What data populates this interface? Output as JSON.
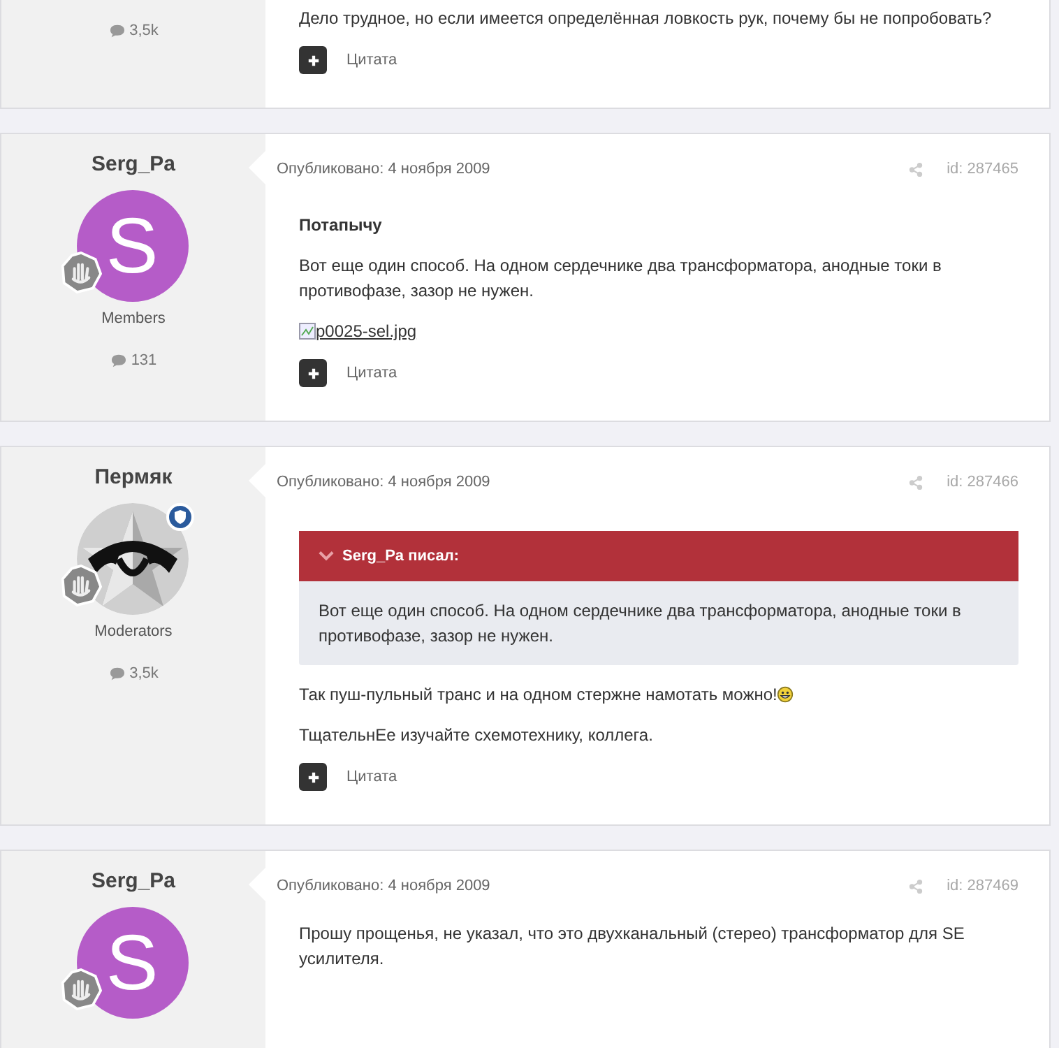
{
  "posts": [
    {
      "posts_count": "3,5k",
      "content": [
        {
          "kind": "paragraph",
          "text": "Дело трудное, но если имеется определённая ловкость рук, почему бы не попробовать?"
        }
      ],
      "quote_label": "Цитата"
    },
    {
      "author": "Serg_Pa",
      "avatar": {
        "kind": "letter",
        "letter": "S",
        "color": "#b55cc8"
      },
      "moderator_badge": false,
      "role": "Members",
      "posts_count": "131",
      "published": "Опубликовано: 4 ноября 2009",
      "post_id": "id: 287465",
      "content": [
        {
          "kind": "heading",
          "text": "Потапычу"
        },
        {
          "kind": "paragraph",
          "text": "Вот еще один способ. На одном сердечнике два трансформатора, анодные токи в противофазе, зазор не нужен."
        },
        {
          "kind": "image_link",
          "text": "p0025-sel.jpg"
        }
      ],
      "quote_label": "Цитата"
    },
    {
      "author": "Пермяк",
      "avatar": {
        "kind": "picture"
      },
      "moderator_badge": true,
      "role": "Moderators",
      "posts_count": "3,5k",
      "published": "Опубликовано: 4 ноября 2009",
      "post_id": "id: 287466",
      "content": [
        {
          "kind": "quote",
          "citation": "Serg_Pa писал:",
          "text": "Вот еще один способ. На одном сердечнике два трансформатора, анодные токи в противофазе, зазор не нужен."
        },
        {
          "kind": "paragraph",
          "text": "Так пуш-пульный транс и на одном стержне намотать можно!",
          "smiley": true
        },
        {
          "kind": "paragraph",
          "text": "ТщательнЕе изучайте схемотехнику, коллега."
        }
      ],
      "quote_label": "Цитата"
    },
    {
      "author": "Serg_Pa",
      "avatar": {
        "kind": "letter",
        "letter": "S",
        "color": "#b55cc8"
      },
      "moderator_badge": false,
      "published": "Опубликовано: 4 ноября 2009",
      "post_id": "id: 287469",
      "content": [
        {
          "kind": "paragraph",
          "text": "Прошу прощенья, не указал, что это двухканальный (стерео) трансформатор для SE усилителя."
        }
      ]
    }
  ]
}
